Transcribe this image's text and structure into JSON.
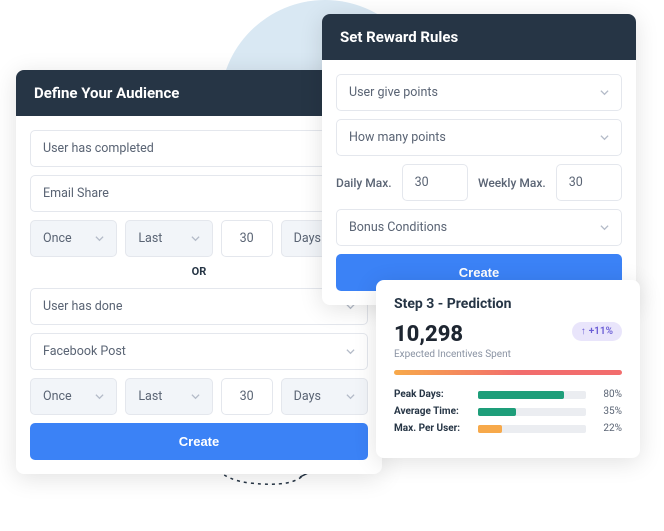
{
  "audience": {
    "title": "Define Your Audience",
    "group1": {
      "condition": "User has completed",
      "action": "Email Share",
      "freq": "Once",
      "period": "Last",
      "count": "30",
      "unit": "Days"
    },
    "or": "OR",
    "group2": {
      "condition": "User has done",
      "action": "Facebook Post",
      "freq": "Once",
      "period": "Last",
      "count": "30",
      "unit": "Days"
    },
    "create": "Create"
  },
  "reward": {
    "title": "Set Reward Rules",
    "points_action": "User give points",
    "points_qty": "How many points",
    "daily_label": "Daily Max.",
    "daily_value": "30",
    "weekly_label": "Weekly Max.",
    "weekly_value": "30",
    "bonus": "Bonus Conditions",
    "create": "Create"
  },
  "prediction": {
    "title": "Step 3 - Prediction",
    "value": "10,298",
    "badge": "+11%",
    "subtitle": "Expected Incentives Spent",
    "stats": [
      {
        "label": "Peak Days:",
        "pct": 80,
        "color": "#1e9e7a"
      },
      {
        "label": "Average Time:",
        "pct": 35,
        "color": "#1e9e7a"
      },
      {
        "label": "Max. Per User:",
        "pct": 22,
        "color": "#f7a94a"
      }
    ]
  }
}
